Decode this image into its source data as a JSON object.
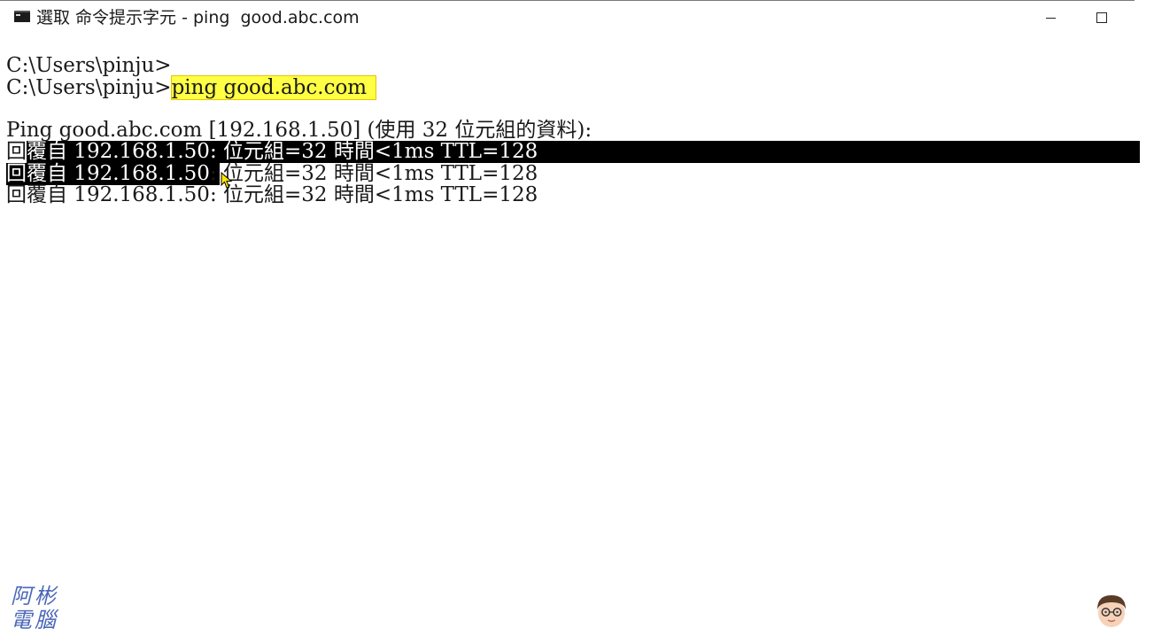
{
  "window": {
    "title": "選取 命令提示字元 - ping  good.abc.com"
  },
  "console": {
    "line1": "C:\\Users\\pinju>",
    "line2_prompt": "C:\\Users\\pinju>",
    "line2_command": "ping good.abc.com",
    "line3": "Ping good.abc.com [192.168.1.50] (使用 32 位元組的資料):",
    "reply1_head": "回",
    "reply1_rest": "覆自 192.168.1.50: 位元組=32 時間<1ms TTL=128",
    "reply2_sel": "回覆自 192.168.1.50",
    "reply2_rest": ": 位元組=32 時間<1ms TTL=128",
    "reply3": "回覆自 192.168.1.50: 位元組=32 時間<1ms TTL=128"
  },
  "watermark": {
    "text": "阿彬電腦"
  },
  "colors": {
    "command_highlight": "#ffff44",
    "selection": "#000000",
    "watermark": "#4a67b8"
  },
  "icons": [
    "console-icon",
    "minimize-icon",
    "maximize-icon",
    "mouse-cursor-icon",
    "avatar-icon"
  ]
}
